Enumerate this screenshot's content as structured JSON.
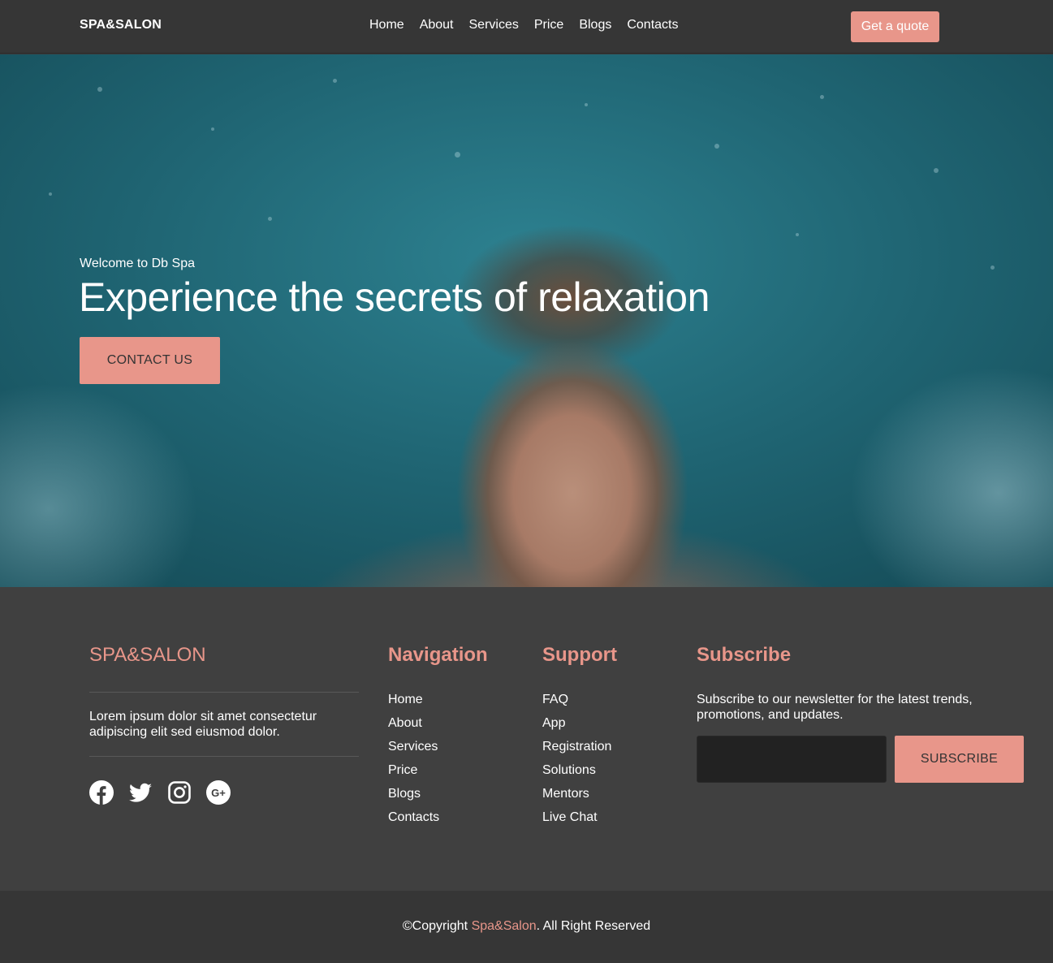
{
  "header": {
    "brand": "SPA&SALON",
    "nav": [
      "Home",
      "About",
      "Services",
      "Price",
      "Blogs",
      "Contacts"
    ],
    "cta": "Get a quote"
  },
  "hero": {
    "welcome": "Welcome to Db Spa",
    "title": "Experience the secrets of relaxation",
    "button": "CONTACT US"
  },
  "footer": {
    "brand": "SPA&SALON",
    "description": "Lorem ipsum dolor sit amet consectetur adipiscing elit sed eiusmod dolor.",
    "socials": [
      "facebook-icon",
      "twitter-icon",
      "instagram-icon",
      "google-plus-icon"
    ],
    "navigation": {
      "title": "Navigation",
      "items": [
        "Home",
        "About",
        "Services",
        "Price",
        "Blogs",
        "Contacts"
      ]
    },
    "support": {
      "title": "Support",
      "items": [
        "FAQ",
        "App",
        "Registration",
        "Solutions",
        "Mentors",
        "Live Chat"
      ]
    },
    "subscribe": {
      "title": "Subscribe",
      "text": "Subscribe to our newsletter for the latest trends, promotions, and updates.",
      "input_value": "",
      "button": "SUBSCRIBE"
    }
  },
  "copyright": {
    "prefix": "©Copyright ",
    "brand": "Spa&Salon",
    "suffix": ". All Right Reserved"
  },
  "colors": {
    "accent": "#e8968a",
    "header_bg": "#363636",
    "footer_bg": "#404040"
  }
}
